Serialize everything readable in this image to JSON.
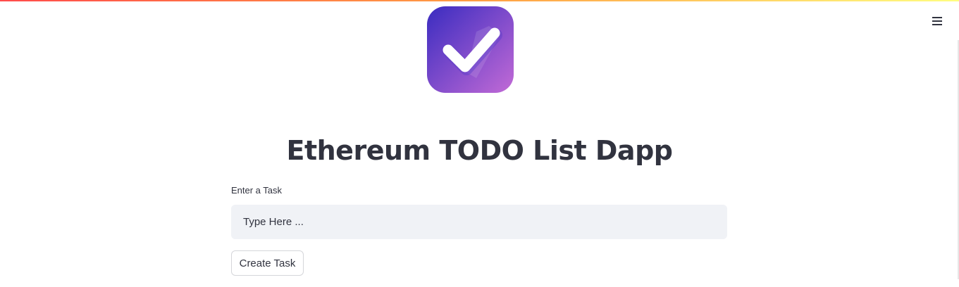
{
  "app": {
    "title": "Ethereum TODO List Dapp",
    "logo_icon": "checkmark-icon",
    "accent_gradient": [
      "#ff4b4b",
      "#ff9f43",
      "#fffd80"
    ],
    "logo_gradient": [
      "#3a2cc0",
      "#c26ad6"
    ]
  },
  "header": {
    "menu_icon": "hamburger-menu-icon"
  },
  "form": {
    "label": "Enter a Task",
    "input_placeholder": "Type Here ...",
    "input_value": "",
    "submit_label": "Create Task"
  }
}
